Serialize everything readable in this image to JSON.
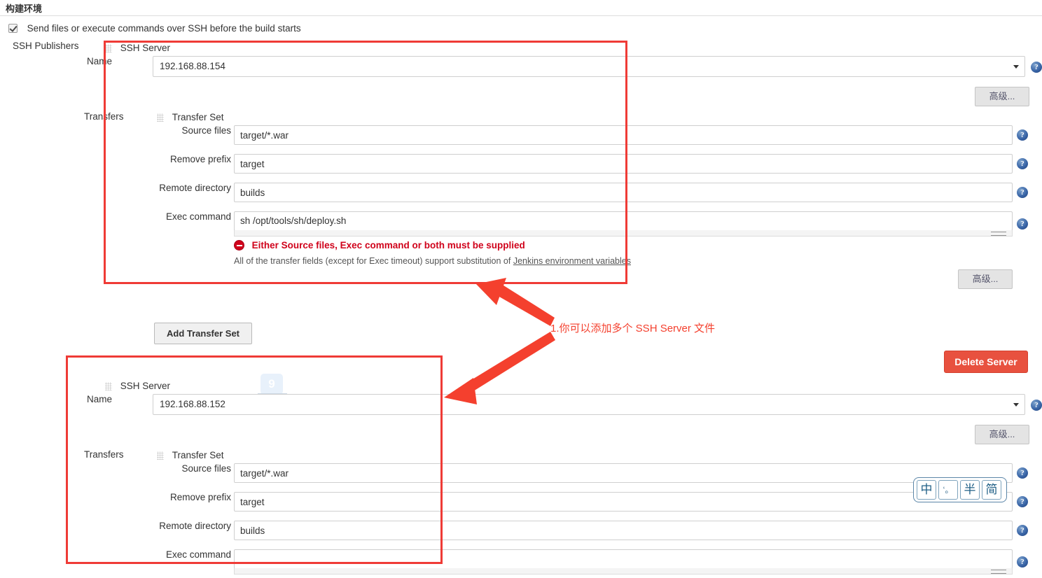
{
  "section": {
    "title": "构建环境",
    "checkbox_label": "Send files or execute commands over SSH before the build starts",
    "publishers_label": "SSH Publishers"
  },
  "labels": {
    "ssh_server": "SSH Server",
    "name": "Name",
    "transfers": "Transfers",
    "transfer_set": "Transfer Set",
    "source_files": "Source files",
    "remove_prefix": "Remove prefix",
    "remote_directory": "Remote directory",
    "exec_command": "Exec command"
  },
  "servers": [
    {
      "name_value": "192.168.88.154",
      "source_files": "target/*.war",
      "remove_prefix": "target",
      "remote_directory": "builds",
      "exec_command": "sh /opt/tools/sh/deploy.sh",
      "error_text": "Either Source files, Exec command or both must be supplied",
      "hint_prefix": "All of the transfer fields (except for Exec timeout) support substitution of ",
      "hint_link": "Jenkins environment variables"
    },
    {
      "name_value": "192.168.88.152",
      "source_files": "target/*.war",
      "remove_prefix": "target",
      "remote_directory": "builds",
      "exec_command": ""
    }
  ],
  "buttons": {
    "advanced": "高级...",
    "add_transfer_set": "Add Transfer Set",
    "delete_server": "Delete Server"
  },
  "help_icon_glyph": "?",
  "annotation": {
    "text": "1.你可以添加多个 SSH Server 文件",
    "color": "#f4402e"
  },
  "ime": {
    "mode": "中",
    "punctuation": "‘。",
    "width": "半",
    "script": "简"
  },
  "colors": {
    "annotation_red": "#ef3b36",
    "error_red": "#d0021b",
    "danger_button": "#e8513f",
    "help_blue": "#3a66a8"
  }
}
